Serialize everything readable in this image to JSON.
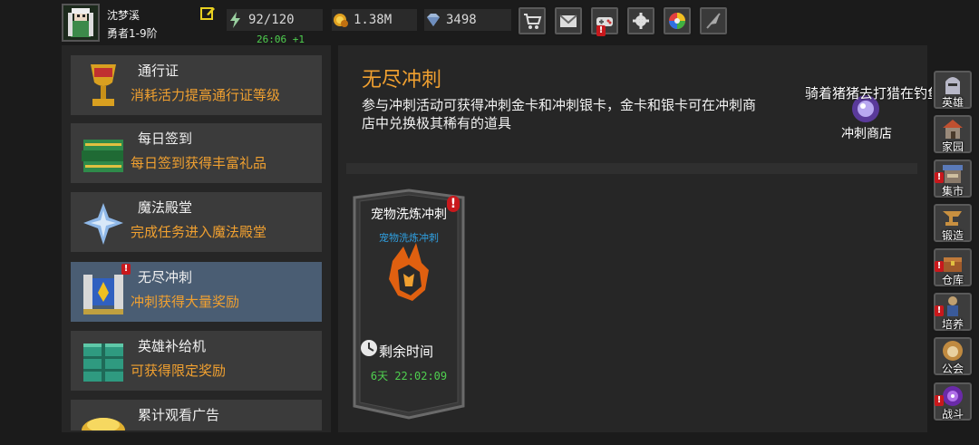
{
  "player": {
    "name": "沈梦溪",
    "rank": "勇者1-9阶"
  },
  "stats": {
    "stamina": "92/120",
    "stamina_timer": "26:06 +1",
    "gold": "1.38M",
    "gems": "3498"
  },
  "top_buttons": [
    "shop-cart-icon",
    "mail-icon",
    "gamepad-icon",
    "settings-gear-icon",
    "color-wheel-icon",
    "feather-icon"
  ],
  "left_menu": [
    {
      "title": "通行证",
      "subtitle": "消耗活力提高通行证等级"
    },
    {
      "title": "每日签到",
      "subtitle": "每日签到获得丰富礼品"
    },
    {
      "title": "魔法殿堂",
      "subtitle": "完成任务进入魔法殿堂"
    },
    {
      "title": "无尽冲刺",
      "subtitle": "冲刺获得大量奖励"
    },
    {
      "title": "英雄补给机",
      "subtitle": "可获得限定奖励"
    },
    {
      "title": "累计观看广告",
      "subtitle": ""
    }
  ],
  "content": {
    "title": "无尽冲刺",
    "description": "参与冲刺活动可获得冲刺金卡和冲刺银卡，金卡和银卡可在冲刺商店中兑换极其稀有的道具",
    "shop_label": "冲刺商店",
    "marquee": "骑着猪猪去打猎在钓鱼场挂"
  },
  "card": {
    "title": "宠物洗炼冲刺",
    "subtitle": "宠物洗炼冲刺",
    "remaining_label": "剩余时间",
    "remaining_time": "6天 22:02:09"
  },
  "side_nav": [
    {
      "label": "英雄"
    },
    {
      "label": "家园"
    },
    {
      "label": "集市"
    },
    {
      "label": "锻造"
    },
    {
      "label": "仓库"
    },
    {
      "label": "培养"
    },
    {
      "label": "公会"
    },
    {
      "label": "战斗"
    }
  ],
  "badge_text": "!",
  "colors": {
    "accent_orange": "#f0a030",
    "active_item": "#4a5d73",
    "timer_green": "#4fd04f",
    "sub_blue": "#2f9fe0",
    "badge_red": "#c8181c"
  }
}
